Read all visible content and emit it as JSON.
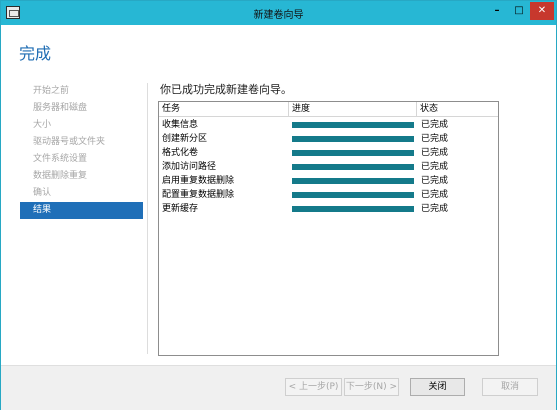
{
  "window": {
    "title": "新建卷向导",
    "controls": {
      "minimize": "–",
      "maximize": "□",
      "close": "✕"
    }
  },
  "page": {
    "title": "完成",
    "heading": "你已成功完成新建卷向导。"
  },
  "steps": [
    {
      "label": "开始之前",
      "active": false
    },
    {
      "label": "服务器和磁盘",
      "active": false
    },
    {
      "label": "大小",
      "active": false
    },
    {
      "label": "驱动器号或文件夹",
      "active": false
    },
    {
      "label": "文件系统设置",
      "active": false
    },
    {
      "label": "数据删除重复",
      "active": false
    },
    {
      "label": "确认",
      "active": false
    },
    {
      "label": "结果",
      "active": true
    }
  ],
  "table": {
    "columns": {
      "task": "任务",
      "progress": "进度",
      "status": "状态"
    },
    "rows": [
      {
        "task": "收集信息",
        "progress": 1.0,
        "status": "已完成"
      },
      {
        "task": "创建新分区",
        "progress": 1.0,
        "status": "已完成"
      },
      {
        "task": "格式化卷",
        "progress": 1.0,
        "status": "已完成"
      },
      {
        "task": "添加访问路径",
        "progress": 1.0,
        "status": "已完成"
      },
      {
        "task": "启用重复数据删除",
        "progress": 1.0,
        "status": "已完成"
      },
      {
        "task": "配置重复数据删除",
        "progress": 1.0,
        "status": "已完成"
      },
      {
        "task": "更新缓存",
        "progress": 1.0,
        "status": "已完成"
      }
    ]
  },
  "buttons": {
    "prev": "< 上一步(P)",
    "next": "下一步(N) >",
    "close": "关闭",
    "cancel": "取消"
  },
  "colors": {
    "titlebar": "#27b7d4",
    "accent": "#1f6fb8",
    "progress": "#147a8a",
    "close_button": "#c7382d"
  }
}
